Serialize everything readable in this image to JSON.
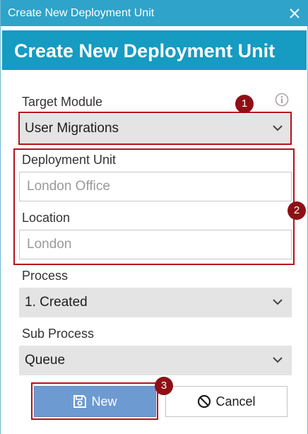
{
  "window": {
    "title": "Create New Deployment Unit",
    "close_icon": "close-icon"
  },
  "header": {
    "title": "Create New Deployment Unit"
  },
  "form": {
    "target_module": {
      "label": "Target Module",
      "value": "User Migrations",
      "info_icon": "info-icon"
    },
    "deployment_unit": {
      "label": "Deployment Unit",
      "placeholder": "London Office",
      "value": ""
    },
    "location": {
      "label": "Location",
      "placeholder": "London",
      "value": ""
    },
    "process": {
      "label": "Process",
      "value": "1. Created"
    },
    "sub_process": {
      "label": "Sub Process",
      "value": "Queue"
    }
  },
  "buttons": {
    "new_label": "New",
    "new_icon": "save-icon",
    "cancel_label": "Cancel",
    "cancel_icon": "cancel-circle-icon"
  },
  "annotations": {
    "badge_1": "1",
    "badge_2": "2",
    "badge_3": "3",
    "highlight_color": "#b5121b",
    "badge_color": "#8e1016"
  },
  "colors": {
    "titlebar": "#2fa3c9",
    "header": "#169bc2",
    "primary_button": "#6d9bd1",
    "select_bg": "#e4e4e4"
  }
}
